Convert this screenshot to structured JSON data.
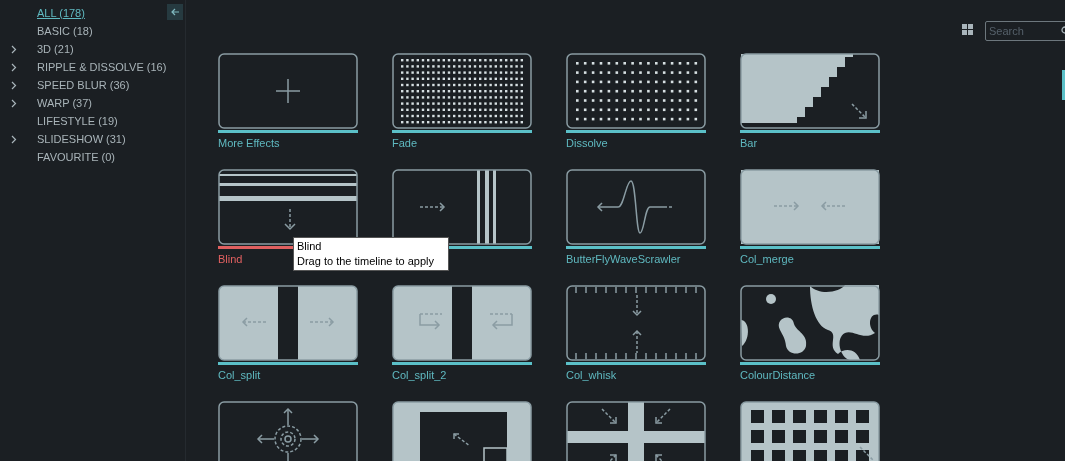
{
  "sidebar": {
    "items": [
      {
        "label": "ALL (178)",
        "expandable": false,
        "selected": true
      },
      {
        "label": "BASIC (18)",
        "expandable": false,
        "selected": false
      },
      {
        "label": "3D (21)",
        "expandable": true,
        "selected": false
      },
      {
        "label": "RIPPLE & DISSOLVE (16)",
        "expandable": true,
        "selected": false
      },
      {
        "label": "SPEED BLUR (36)",
        "expandable": true,
        "selected": false
      },
      {
        "label": "WARP (37)",
        "expandable": true,
        "selected": false
      },
      {
        "label": "LIFESTYLE (19)",
        "expandable": false,
        "selected": false
      },
      {
        "label": "SLIDESHOW (31)",
        "expandable": true,
        "selected": false
      },
      {
        "label": "FAVOURITE (0)",
        "expandable": false,
        "selected": false
      }
    ]
  },
  "search": {
    "placeholder": "Search"
  },
  "effects": [
    {
      "kind": "add",
      "label": "More Effects",
      "selected": false
    },
    {
      "kind": "fade",
      "label": "Fade",
      "selected": false
    },
    {
      "kind": "dissolve",
      "label": "Dissolve",
      "selected": false
    },
    {
      "kind": "stairs",
      "label": "Bar",
      "selected": false
    },
    {
      "kind": "blinds",
      "label": "Blind",
      "selected": true
    },
    {
      "kind": "stripes",
      "selected": false
    },
    {
      "kind": "wave",
      "label": "ButterFlyWaveScrawler",
      "selected": false
    },
    {
      "kind": "merge",
      "label": "Col_merge",
      "selected": false
    },
    {
      "kind": "split",
      "label": "Col_split",
      "selected": false
    },
    {
      "kind": "hooks",
      "label": "Col_split_2",
      "selected": false
    },
    {
      "kind": "whisk",
      "label": "Col_whisk",
      "selected": false
    },
    {
      "kind": "blobs",
      "label": "ColourDistance",
      "selected": false
    },
    {
      "kind": "radial"
    },
    {
      "kind": "corner"
    },
    {
      "kind": "cross"
    },
    {
      "kind": "tiles"
    }
  ],
  "tooltip": {
    "title": "Blind",
    "text": "Drag to the timeline to apply"
  }
}
